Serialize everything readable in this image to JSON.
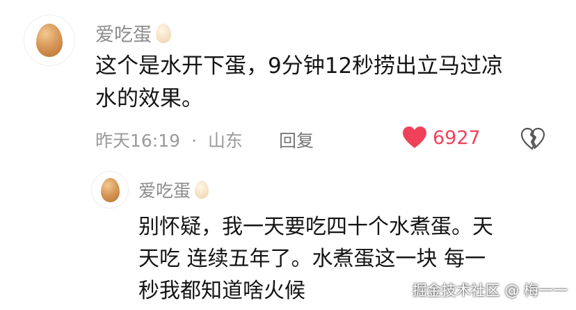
{
  "comment": {
    "username": "爱吃蛋",
    "text_line1": "这个是水开下蛋，9分钟12秒捞出立马过凉",
    "text_line2": "水的效果。",
    "timestamp": "昨天16:19",
    "separator": "·",
    "location": "山东",
    "reply_label": "回复",
    "like_count": "6927",
    "avatar_icon": "egg-icon",
    "badge_icon": "egg-badge-icon",
    "like_icon": "heart-icon",
    "dislike_icon": "broken-heart-icon",
    "like_color": "#f0415a"
  },
  "reply": {
    "username": "爱吃蛋",
    "text_line1": "别怀疑，我一天要吃四十个水煮蛋。天",
    "text_line2": "天吃 连续五年了。水煮蛋这一块 每一",
    "text_line3": "秒我都知道啥火候",
    "avatar_icon": "egg-icon",
    "badge_icon": "egg-badge-icon"
  },
  "watermark": "掘金技术社区 @ 梅一一"
}
